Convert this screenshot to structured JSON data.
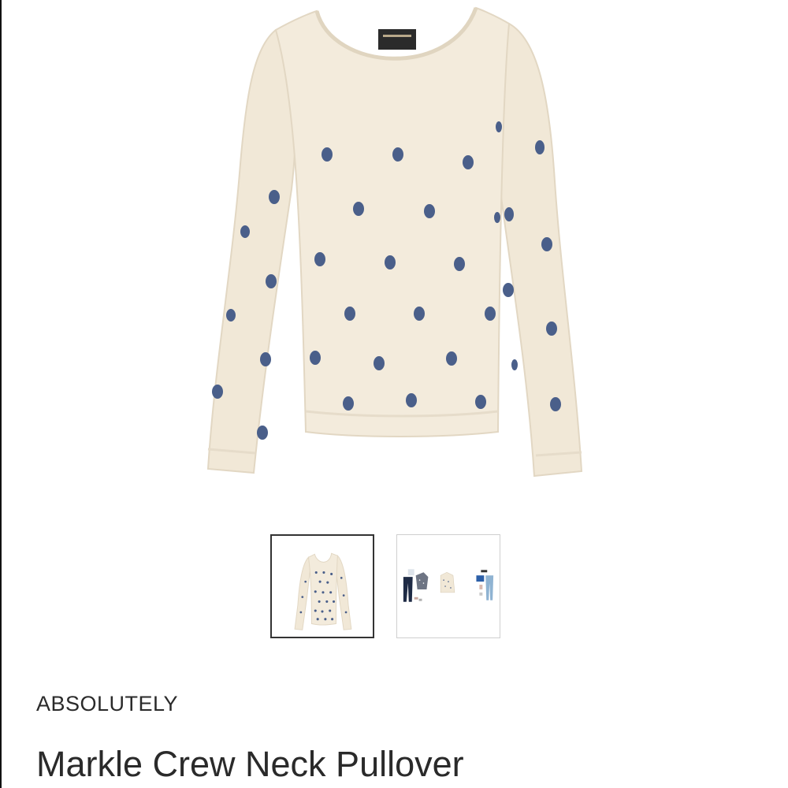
{
  "colors": {
    "sweater": "#f3ebdc",
    "sweater_shadow": "#e6dcca",
    "dot": "#4a5f8a",
    "text": "#2a2a2a",
    "thumb_selected_border": "#333333",
    "thumb_border": "#cfcfcf"
  },
  "product": {
    "main_image_icon": "polka-dot-sweater-image",
    "brand": "ABSOLUTELY",
    "name": "Markle Crew Neck Pullover"
  },
  "gallery": {
    "thumbnails": [
      {
        "icon": "sweater-thumbnail",
        "selected": true
      },
      {
        "icon": "outfit-thumbnail",
        "selected": false
      }
    ]
  }
}
